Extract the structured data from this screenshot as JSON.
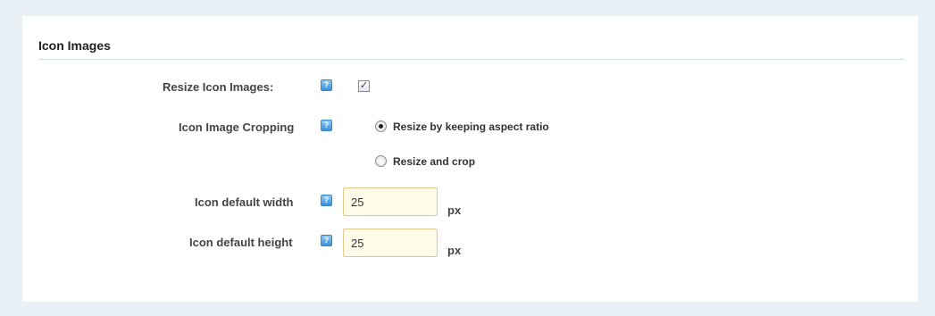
{
  "section": {
    "title": "Icon Images"
  },
  "help_icon": {
    "glyph": "?",
    "name": "help-icon"
  },
  "resize": {
    "label": "Resize Icon Images:",
    "checked": true,
    "check_glyph": "✓"
  },
  "cropping": {
    "label": "Icon Image Cropping",
    "options": [
      {
        "label": "Resize by keeping aspect ratio",
        "selected": true
      },
      {
        "label": "Resize and crop",
        "selected": false
      }
    ]
  },
  "width": {
    "label": "Icon default width",
    "value": "25",
    "unit": "px"
  },
  "height": {
    "label": "Icon default height",
    "value": "25",
    "unit": "px"
  },
  "colors": {
    "background": "#eaf1f6",
    "panel": "#ffffff",
    "input_bg": "#fffbe9",
    "input_border": "#e0c889",
    "help_blue": "#3b91d6"
  }
}
